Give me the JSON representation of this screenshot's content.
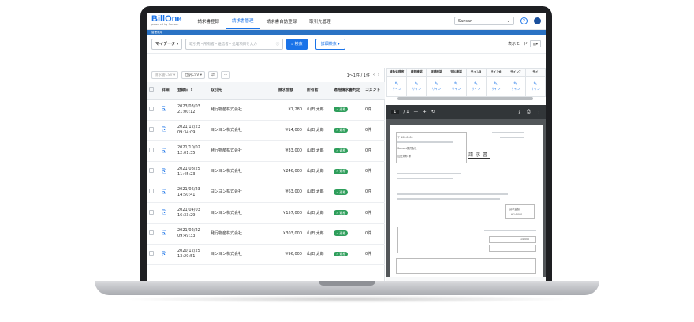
{
  "app": {
    "logo": "Bill",
    "logo_accent": "One",
    "logo_sub": "powered by Sansan",
    "nav": [
      "請求書登録",
      "請求書管理",
      "請求書自動登録",
      "取引先管理"
    ],
    "active_nav": 1,
    "company": "Sansan",
    "banner": "管理運用"
  },
  "search": {
    "master_label": "マイデータ",
    "placeholder": "取引先・所有者・送信者・処理項目を入力",
    "search_button": "検索",
    "advanced_button": "詳細検索",
    "view_mode_label": "表示モード"
  },
  "toolbar": {
    "csv_button": "請求書CSV",
    "journal_button": "仕訳CSV",
    "pager": "1〜1件 / 1件"
  },
  "table": {
    "headers": [
      "詳細",
      "登録日 ⇕",
      "取引先",
      "請求金額",
      "所有者",
      "適格請求書判定",
      "コメント"
    ],
    "rows": [
      {
        "date": "2023/03/03",
        "time": "21:00:12",
        "vendor": "発行物産株式会社",
        "amount": "¥1,280",
        "owner": "山田 太郎",
        "status": "適格",
        "comment": "0件"
      },
      {
        "date": "2021/12/23",
        "time": "09:34:09",
        "vendor": "ヨンヨン株式会社",
        "amount": "¥14,000",
        "owner": "山田 太郎",
        "status": "適格",
        "comment": "0件"
      },
      {
        "date": "2021/10/02",
        "time": "12:01:35",
        "vendor": "発行物産株式会社",
        "amount": "¥33,000",
        "owner": "山田 太郎",
        "status": "適格",
        "comment": "0件"
      },
      {
        "date": "2021/08/25",
        "time": "11:45:23",
        "vendor": "ヨンヨン株式会社",
        "amount": "¥246,000",
        "owner": "山田 太郎",
        "status": "適格",
        "comment": "0件"
      },
      {
        "date": "2021/06/23",
        "time": "14:50:41",
        "vendor": "ヨンヨン株式会社",
        "amount": "¥63,000",
        "owner": "山田 太郎",
        "status": "適格",
        "comment": "0件"
      },
      {
        "date": "2021/04/03",
        "time": "16:33:29",
        "vendor": "ヨンヨン株式会社",
        "amount": "¥157,000",
        "owner": "山田 太郎",
        "status": "適格",
        "comment": "0件"
      },
      {
        "date": "2021/02/22",
        "time": "09:49:33",
        "vendor": "発行物産株式会社",
        "amount": "¥303,000",
        "owner": "山田 太郎",
        "status": "適格",
        "comment": "0件"
      },
      {
        "date": "2020/12/25",
        "time": "13:29:51",
        "vendor": "ヨンヨン株式会社",
        "amount": "¥96,000",
        "owner": "山田 太郎",
        "status": "適格",
        "comment": "0件"
      }
    ]
  },
  "stamps": {
    "headers": [
      "請負処理官",
      "請負確認",
      "経理確認",
      "支払確認",
      "サイン5",
      "サイン6",
      "サイン7",
      "サイ"
    ],
    "sign_label": "サイン"
  },
  "pdf": {
    "page_current": "1",
    "page_total": "/ 1",
    "zoom_minus": "—",
    "zoom_plus": "+",
    "title": "請求書",
    "issuer_zip": "〒 100-0000",
    "customer": "Sansan株式会社",
    "attention": "山田太郎 様",
    "total_label": "請求金額",
    "total_value": "¥ 14,000",
    "line_total": "14,000"
  }
}
